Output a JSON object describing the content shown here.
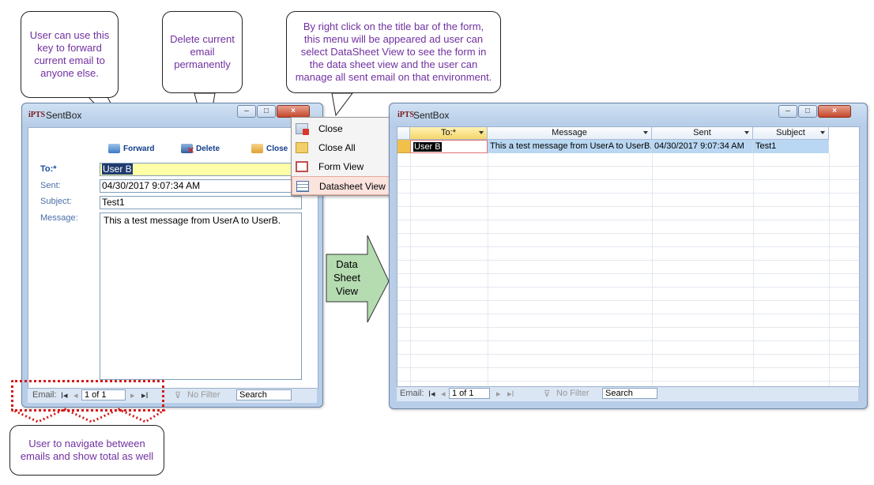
{
  "callouts": {
    "forward_note": "User can use this key to forward current email to anyone else.",
    "delete_note": "Delete current email permanently",
    "menu_note": "By right click on the title bar of the form, this menu will be appeared ad user can select DataSheet View to see the form in the data sheet view and the user can manage all sent email on that environment.",
    "nav_note": "User to navigate between emails and show total as well",
    "arrow_label": "Data Sheet View"
  },
  "form_window": {
    "logo": "iPTS",
    "title": "SentBox",
    "toolbar": {
      "forward": "Forward",
      "delete": "Delete",
      "close": "Close"
    },
    "labels": {
      "to": "To:*",
      "sent": "Sent:",
      "subject": "Subject:",
      "message": "Message:"
    },
    "values": {
      "to": "User B",
      "sent": "04/30/2017 9:07:34 AM",
      "subject": "Test1",
      "message": "This a test message from UserA to UserB."
    },
    "nav": {
      "record_label": "Email:",
      "position": "1 of 1",
      "filter": "No Filter",
      "search": "Search"
    }
  },
  "context_menu": {
    "items": [
      "Close",
      "Close All",
      "Form View",
      "Datasheet View"
    ],
    "highlighted": "Datasheet View"
  },
  "datasheet_window": {
    "logo": "iPTS",
    "title": "SentBox",
    "columns": [
      "To:*",
      "Message",
      "Sent",
      "Subject"
    ],
    "rows": [
      [
        "User B",
        "This a test message from UserA to UserB.",
        "04/30/2017 9:07:34 AM",
        "Test1"
      ]
    ],
    "nav": {
      "record_label": "Email:",
      "position": "1 of 1",
      "filter": "No Filter",
      "search": "Search"
    }
  },
  "colors": {
    "accent_purple": "#7030a0",
    "window_frame": "#b7cde8",
    "arrow_fill": "#b5dbb0",
    "highlight": "#fbe3de"
  }
}
